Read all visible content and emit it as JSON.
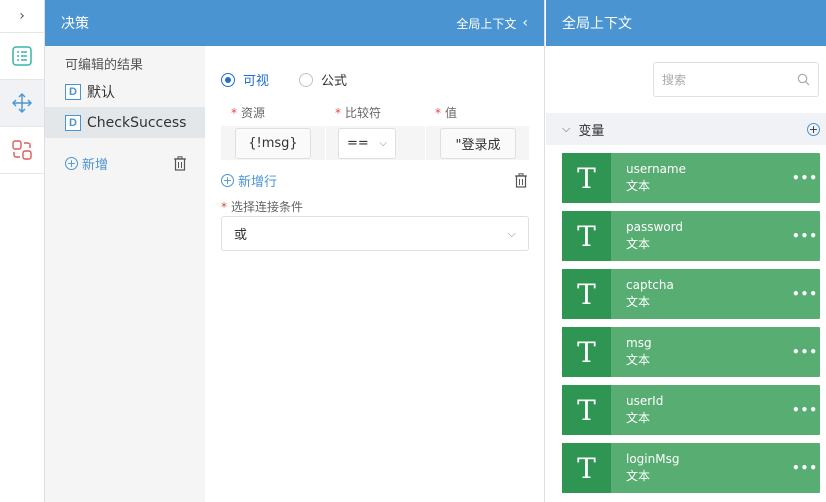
{
  "decision": {
    "title": "决策",
    "global_context_btn": "全局上下文",
    "results_label": "可编辑的结果",
    "results": [
      {
        "badge": "D",
        "label": "默认"
      },
      {
        "badge": "D",
        "label": "CheckSuccess"
      }
    ],
    "add_label": "新增",
    "modes": [
      "可视",
      "公式"
    ],
    "selected_mode": "可视",
    "columns": {
      "source": "资源",
      "comparator": "比较符",
      "value": "值"
    },
    "row": {
      "source": "{!msg}",
      "comparator": "==",
      "value": "\"登录成"
    },
    "add_row_label": "新增行",
    "connection_label": "选择连接条件",
    "connection_value": "或"
  },
  "context": {
    "title": "全局上下文",
    "search_placeholder": "搜索",
    "section_title": "变量",
    "variables": [
      {
        "icon": "T",
        "name": "username",
        "type": "文本"
      },
      {
        "icon": "T",
        "name": "password",
        "type": "文本"
      },
      {
        "icon": "T",
        "name": "captcha",
        "type": "文本"
      },
      {
        "icon": "T",
        "name": "msg",
        "type": "文本"
      },
      {
        "icon": "T",
        "name": "userId",
        "type": "文本"
      },
      {
        "icon": "T",
        "name": "loginMsg",
        "type": "文本"
      }
    ]
  },
  "colors": {
    "header": "#4a94d2",
    "card": "#57ad72",
    "card_icon": "#2f9552",
    "accent": "#1f6fd6"
  }
}
